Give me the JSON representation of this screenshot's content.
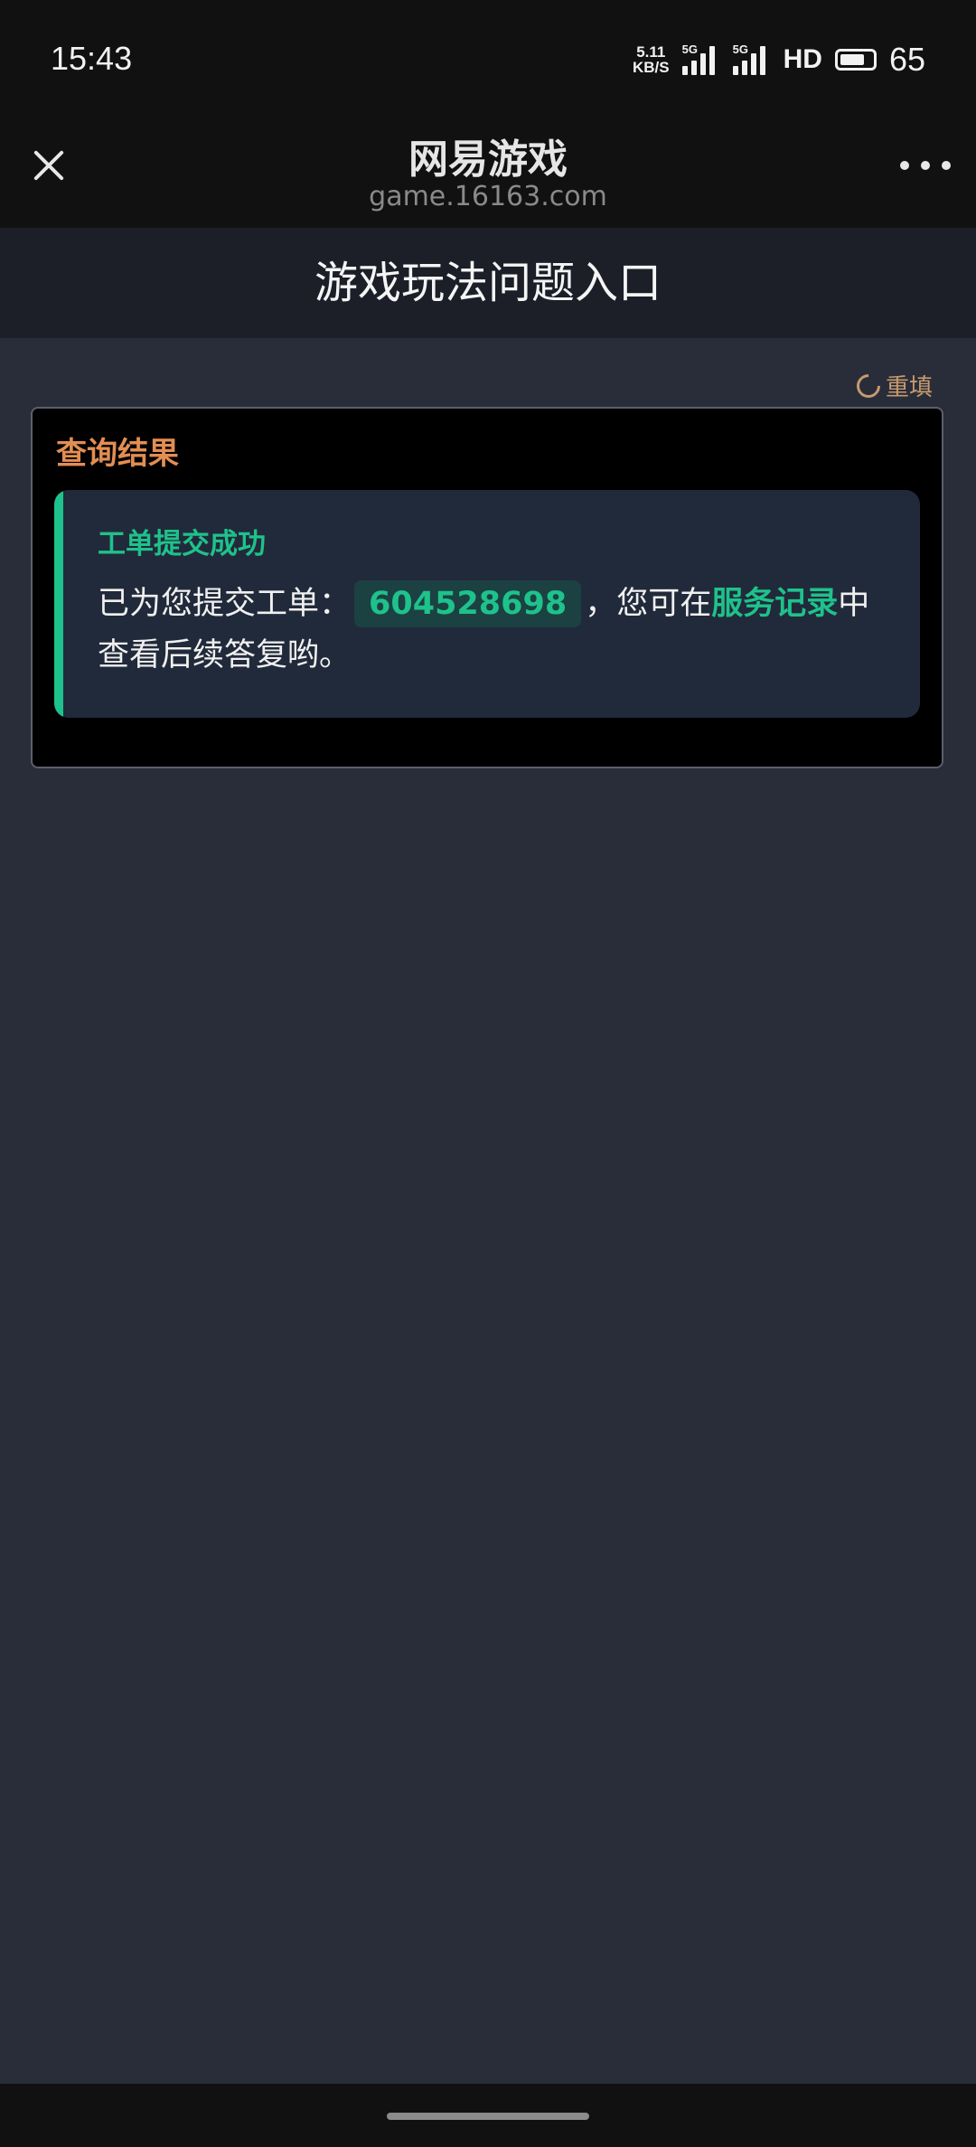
{
  "status_bar": {
    "time": "15:43",
    "net_speed_value": "5.11",
    "net_speed_unit": "KB/S",
    "sim1_tag": "5G",
    "sim2_tag": "5G",
    "hd_label": "HD",
    "battery_level": "65"
  },
  "nav": {
    "title": "网易游戏",
    "url": "game.16163.com"
  },
  "page": {
    "header_title": "游戏玩法问题入口",
    "refill_label": "重填"
  },
  "result": {
    "section_title": "查询结果",
    "success_title": "工单提交成功",
    "text_before_ticket": "已为您提交工单：",
    "ticket_number": "604528698",
    "text_mid": "，您可在",
    "service_link": "服务记录",
    "text_after": "中查看后续答复哟。"
  },
  "colors": {
    "accent_green": "#1ec28b",
    "section_orange": "#e28e53",
    "refill_brown": "#c79a6d"
  }
}
